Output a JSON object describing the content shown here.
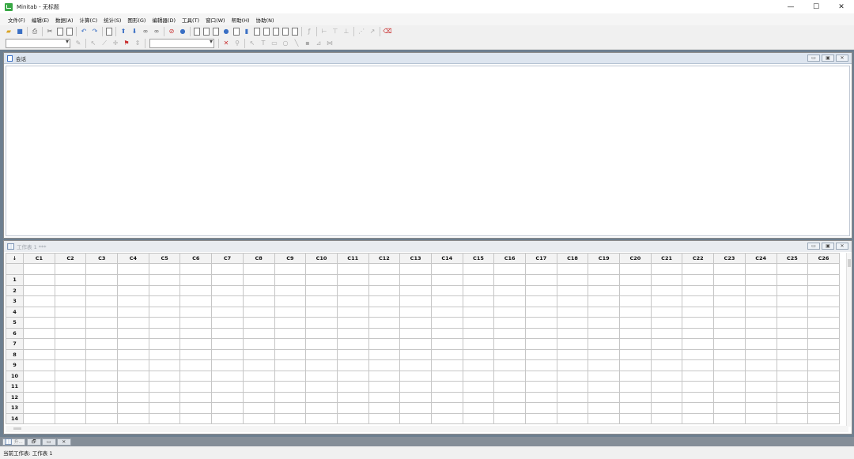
{
  "window": {
    "title": "Minitab - 无标题",
    "controls": [
      "—",
      "☐",
      "✕"
    ]
  },
  "menu": [
    "文件(F)",
    "编辑(E)",
    "数据(A)",
    "计算(C)",
    "统计(S)",
    "图形(G)",
    "编辑器(D)",
    "工具(T)",
    "窗口(W)",
    "帮助(H)",
    "协助(N)"
  ],
  "toolbar1": [
    "open-icon",
    "save-icon",
    "print-icon",
    "|",
    "cut-icon",
    "copy-icon",
    "paste-icon",
    "|",
    "undo-icon",
    "redo-icon",
    "|",
    "blank-icon",
    "|",
    "arrow-up-icon",
    "arrow-down-icon",
    "binoculars-icon",
    "binoculars-next-icon",
    "|",
    "stop-icon",
    "help-icon",
    "|",
    "session-window-icon",
    "worksheets-icon",
    "project-manager-icon",
    "info-icon",
    "history-icon",
    "graphs-icon",
    "report-icon",
    "related-docs-icon",
    "design-icon",
    "layout-icon",
    "tile-icon",
    "|",
    "fx-icon",
    "|",
    "branch-icon",
    "tree-icon",
    "hierarchy-icon",
    "|",
    "scatter-icon",
    "trend-icon",
    "|",
    "eraser-icon"
  ],
  "toolbar2": [
    "combo",
    "brush-icon",
    "|",
    "select-icon",
    "brush-tool-icon",
    "crosshair-icon",
    "flag-icon",
    "jump-icon",
    "|",
    "combo",
    "|",
    "delete-icon",
    "zoom-icon",
    "|",
    "pointer-icon",
    "text-icon",
    "rect-icon",
    "ellipse-icon",
    "line-icon",
    "dot-icon",
    "polygon-icon",
    "polyline-icon"
  ],
  "session": {
    "title": "会话",
    "controls": [
      "▭",
      "▣",
      "✕"
    ]
  },
  "worksheet": {
    "title": "工作表 1 ***",
    "controls": [
      "▭",
      "▣",
      "✕"
    ],
    "corner": "↓",
    "columns": [
      "C1",
      "C2",
      "C3",
      "C4",
      "C5",
      "C6",
      "C7",
      "C8",
      "C9",
      "C10",
      "C11",
      "C12",
      "C13",
      "C14",
      "C15",
      "C16",
      "C17",
      "C18",
      "C19",
      "C20",
      "C21",
      "C22",
      "C23",
      "C24",
      "C25",
      "C26"
    ],
    "rows": [
      "1",
      "2",
      "3",
      "4",
      "5",
      "6",
      "7",
      "8",
      "9",
      "10",
      "11",
      "12",
      "13",
      "14"
    ]
  },
  "taskbar": {
    "minimized_label": "升...",
    "buttons": [
      "🗗",
      "▭",
      "✕"
    ]
  },
  "status": {
    "text": "当前工作表: 工作表 1"
  }
}
